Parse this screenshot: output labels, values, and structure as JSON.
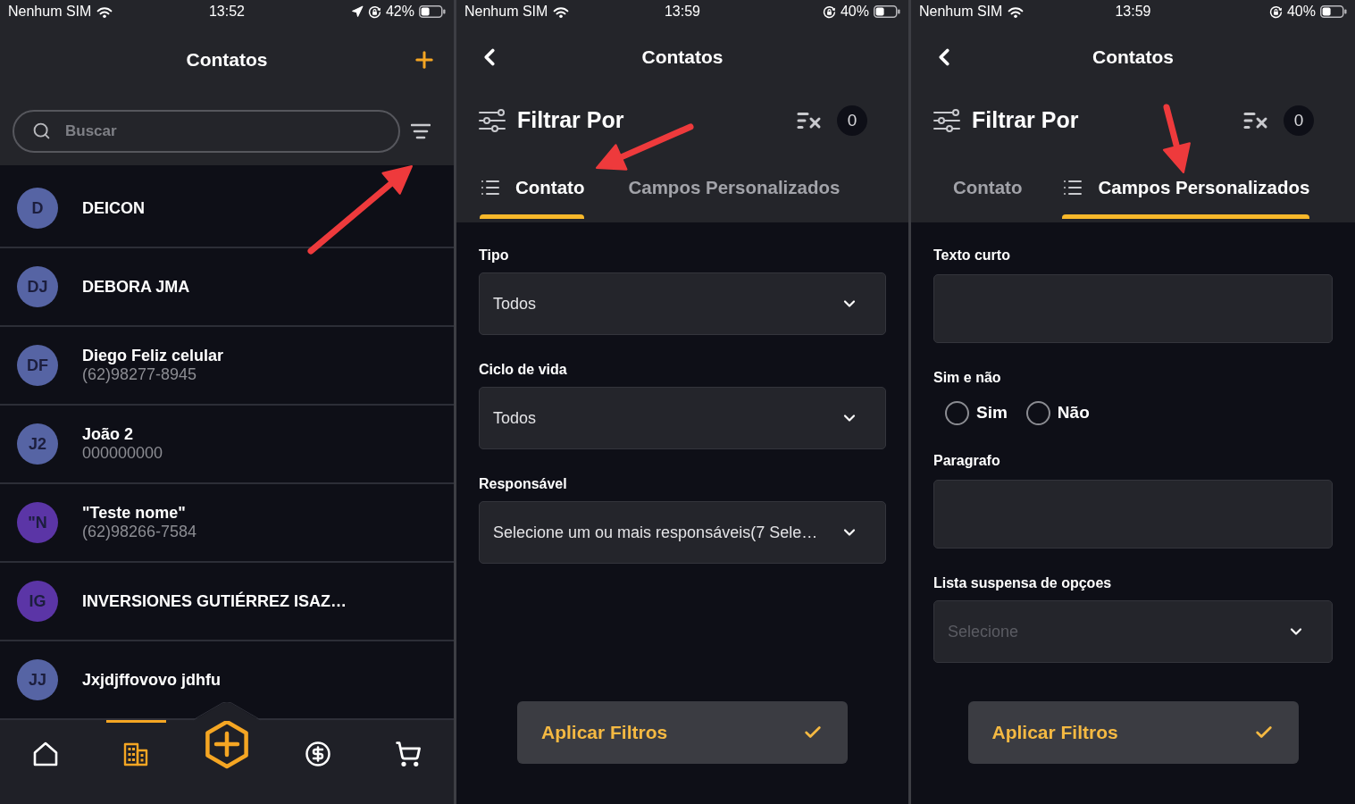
{
  "screens": [
    {
      "kind": "contacts",
      "status_bar": {
        "carrier": "Nenhum SIM",
        "time": "13:52",
        "location": true,
        "battery": "42%"
      },
      "title": "Contatos",
      "search": {
        "placeholder": "Buscar"
      },
      "contacts": [
        {
          "initials": "D",
          "name": "DEICON",
          "color": "#5664a4"
        },
        {
          "initials": "DJ",
          "name": "DEBORA JMA",
          "color": "#5664a4"
        },
        {
          "initials": "DF",
          "name": "Diego Feliz celular",
          "phone": "(62)98277-8945",
          "color": "#5664a4"
        },
        {
          "initials": "J2",
          "name": "João 2",
          "phone": "000000000",
          "color": "#5664a4"
        },
        {
          "initials": "\"N",
          "name": "\"Teste nome\"",
          "phone": "(62)98266-7584",
          "color": "#5b35a6"
        },
        {
          "initials": "IG",
          "name": "INVERSIONES GUTIÉRREZ ISAZ…",
          "color": "#5b35a6"
        },
        {
          "initials": "JJ",
          "name": "Jxjdjffovovo jdhfu",
          "color": "#5664a4"
        }
      ],
      "bottom_nav": [
        {
          "kind": "home",
          "selected": false
        },
        {
          "kind": "company",
          "selected": true
        },
        {
          "kind": "add"
        },
        {
          "kind": "money",
          "selected": false
        },
        {
          "kind": "cart",
          "selected": false
        }
      ]
    },
    {
      "kind": "filters",
      "status_bar": {
        "carrier": "Nenhum SIM",
        "time": "13:59",
        "location": false,
        "battery": "40%"
      },
      "title": "Contatos",
      "filter_heading": "Filtrar Por",
      "active_count": "0",
      "tabs": [
        {
          "label": "Contato",
          "selected": true
        },
        {
          "label": "Campos Personalizados",
          "selected": false
        }
      ],
      "fields": [
        {
          "kind": "select",
          "label": "Tipo",
          "value": "Todos"
        },
        {
          "kind": "select",
          "label": "Ciclo de vida",
          "value": "Todos"
        },
        {
          "kind": "select",
          "label": "Responsável",
          "value": "Selecione um ou mais responsáveis(7 Sele…"
        }
      ],
      "apply_button": "Aplicar Filtros"
    },
    {
      "kind": "filters",
      "status_bar": {
        "carrier": "Nenhum SIM",
        "time": "13:59",
        "location": false,
        "battery": "40%"
      },
      "title": "Contatos",
      "filter_heading": "Filtrar Por",
      "active_count": "0",
      "tabs": [
        {
          "label": "Contato",
          "selected": false
        },
        {
          "label": "Campos Personalizados",
          "selected": true
        }
      ],
      "fields": [
        {
          "kind": "text",
          "label": "Texto curto"
        },
        {
          "kind": "radio",
          "label": "Sim e não",
          "options": [
            {
              "label": "Sim",
              "selected": false
            },
            {
              "label": "Não",
              "selected": false
            }
          ]
        },
        {
          "kind": "textarea",
          "label": "Paragrafo"
        },
        {
          "kind": "select",
          "label": "Lista suspensa de opçoes",
          "placeholder": "Selecione"
        }
      ],
      "apply_button": "Aplicar Filtros"
    }
  ]
}
